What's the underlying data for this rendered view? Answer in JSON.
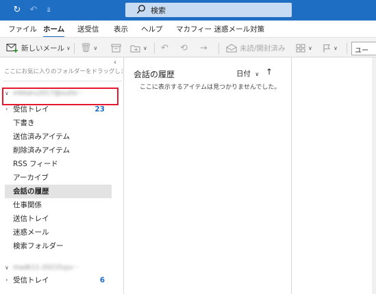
{
  "titlebar": {
    "sync_icon": "sync-icon",
    "undo_icon": "undo-icon",
    "customize_icon": "customize-quick-access-icon",
    "search_placeholder": "検索"
  },
  "tabs": [
    {
      "label": "ファイル",
      "active": false
    },
    {
      "label": "ホーム",
      "active": true
    },
    {
      "label": "送受信",
      "active": false
    },
    {
      "label": "表示",
      "active": false
    },
    {
      "label": "ヘルプ",
      "active": false
    },
    {
      "label": "マカフィー 迷惑メール対策",
      "active": false
    }
  ],
  "ribbon": {
    "new_mail_label": "新しいメール",
    "mark_read_label": "未読/開封済み",
    "search_people_label": "ユー"
  },
  "folder_pane": {
    "favorites_hint": "ここにお気に入りのフォルダーをドラッグします",
    "collapse_glyph": "‹",
    "account1": "mkkaru2017@outlo···",
    "account2": "madk11-2021fuyu···",
    "folders": [
      {
        "label": "受信トレイ",
        "count": "23",
        "expandable": true,
        "selected": false
      },
      {
        "label": "下書き",
        "count": "",
        "expandable": false,
        "selected": false
      },
      {
        "label": "送信済みアイテム",
        "count": "",
        "expandable": false,
        "selected": false
      },
      {
        "label": "削除済みアイテム",
        "count": "",
        "expandable": false,
        "selected": false
      },
      {
        "label": "RSS フィード",
        "count": "",
        "expandable": false,
        "selected": false
      },
      {
        "label": "アーカイブ",
        "count": "",
        "expandable": false,
        "selected": false
      },
      {
        "label": "会話の履歴",
        "count": "",
        "expandable": false,
        "selected": true
      },
      {
        "label": "仕事関係",
        "count": "",
        "expandable": false,
        "selected": false
      },
      {
        "label": "送信トレイ",
        "count": "",
        "expandable": false,
        "selected": false
      },
      {
        "label": "迷惑メール",
        "count": "",
        "expandable": false,
        "selected": false
      },
      {
        "label": "検索フォルダー",
        "count": "",
        "expandable": false,
        "selected": false
      }
    ],
    "account2_folders": [
      {
        "label": "受信トレイ",
        "count": "6",
        "expandable": true
      }
    ]
  },
  "list_pane": {
    "title": "会話の履歴",
    "sort_label": "日付",
    "empty_message": "ここに表示するアイテムは見つかりませんでした。"
  },
  "colors": {
    "accent": "#1e6fc4",
    "highlight_box": "#e5172d",
    "selected_bg": "#e3e3e3"
  }
}
